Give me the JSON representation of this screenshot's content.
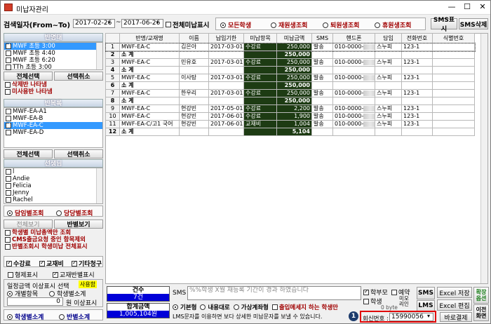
{
  "window": {
    "title": "미납자관리"
  },
  "search": {
    "label": "검색일자(From~To)",
    "from": "2017-02-26",
    "tilde": "~",
    "to": "2017-06-26",
    "all_unpaid": "전체미납표시"
  },
  "filters": {
    "all": "모든학생",
    "enrolled": "재원생조회",
    "withdrawn": "퇴원생조회",
    "leave": "휴원생조회"
  },
  "top_buttons": {
    "sms_show": "SMS표시",
    "sms_delete": "SMS삭제"
  },
  "class_section": {
    "title": "반명태",
    "items": [
      {
        "label": "MWF 초등 3:00",
        "checked": true,
        "selected": true
      },
      {
        "label": "MWF 초등 4:40",
        "checked": false
      },
      {
        "label": "MWF 초등 6:20",
        "checked": false
      },
      {
        "label": "TTh 초등 3:00",
        "checked": false
      }
    ],
    "select_all": "전체선택",
    "deselect": "선택취소",
    "options": [
      "삭제반 나타냄",
      "미사용반 나타냄"
    ]
  },
  "group_section": {
    "title": "반목록",
    "items": [
      {
        "label": "MWF-EA-A1",
        "checked": false
      },
      {
        "label": "MWF-EA-B",
        "checked": false
      },
      {
        "label": "MWF-EA-C",
        "checked": true,
        "selected": true
      },
      {
        "label": "MWF-EA-D",
        "checked": false
      }
    ],
    "select_all": "전체선택",
    "deselect": "선택취소"
  },
  "teacher_section": {
    "title": "선생님",
    "items": [
      {
        "label": "l",
        "checked": false
      },
      {
        "label": "Andie",
        "checked": false
      },
      {
        "label": "Felicia",
        "checked": false
      },
      {
        "label": "Jenny",
        "checked": false
      },
      {
        "label": "Rachel",
        "checked": false
      }
    ]
  },
  "teacher_query": {
    "by_teacher": "담임별조회",
    "by_staff": "당당별조회"
  },
  "view_tabs": {
    "all": "전체보기",
    "by_class": "반별보기"
  },
  "options": {
    "student_total_only": "학생별 미납총액만 조회",
    "cms_exclude": "CMS출금요청 중인 항목제외",
    "class_all_unpaid": "반별조회시 학생미납 전체표시"
  },
  "types": {
    "tuition": "수강료",
    "material": "교재비",
    "other": "기타청구"
  },
  "sibling": "형제표시",
  "material_class": "교재반별표시",
  "amount_filter": {
    "label": "일정금액 이상표시 선택",
    "badge": "사용함",
    "per_item": "개별항목",
    "per_student": "학생별소계",
    "value": "0",
    "unit": "원 이상표시"
  },
  "subtotal_tabs": {
    "student": "학생별소계",
    "class": "반별소계"
  },
  "table": {
    "headers": [
      "",
      "반명/교재명",
      "이름",
      "납입기한",
      "미납항목",
      "미납금액",
      "SMS",
      "핸드폰",
      "담임",
      "전화번호",
      "식별번호"
    ],
    "rows": [
      {
        "n": "1",
        "class": "MWF-EA-C",
        "name": "김은아",
        "due": "2017-03-01",
        "item": "수강료",
        "amount": "250,000",
        "sms": "발송",
        "phone": "010-0000-",
        "teacher": "스누피",
        "tel": "123-1",
        "sub": false
      },
      {
        "n": "2",
        "class": "소 계",
        "name": "",
        "due": "",
        "item": "",
        "amount": "250,000",
        "sms": "",
        "phone": "",
        "teacher": "",
        "tel": "",
        "sub": true
      },
      {
        "n": "3",
        "class": "MWF-EA-C",
        "name": "민유호",
        "due": "2017-03-01",
        "item": "수강료",
        "amount": "250,000",
        "sms": "발송",
        "phone": "010-0000-",
        "teacher": "스누피",
        "tel": "123-1",
        "sub": false
      },
      {
        "n": "4",
        "class": "소 계",
        "name": "",
        "due": "",
        "item": "",
        "amount": "250,000",
        "sms": "",
        "phone": "",
        "teacher": "",
        "tel": "",
        "sub": true
      },
      {
        "n": "5",
        "class": "MWF-EA-C",
        "name": "이사탕",
        "due": "2017-03-01",
        "item": "수강료",
        "amount": "250,000",
        "sms": "발송",
        "phone": "010-0000-",
        "teacher": "스누피",
        "tel": "123-1",
        "sub": false
      },
      {
        "n": "6",
        "class": "소 계",
        "name": "",
        "due": "",
        "item": "",
        "amount": "250,000",
        "sms": "",
        "phone": "",
        "teacher": "",
        "tel": "",
        "sub": true
      },
      {
        "n": "7",
        "class": "MWF-EA-C",
        "name": "한우리",
        "due": "2017-03-01",
        "item": "수강료",
        "amount": "250,000",
        "sms": "발송",
        "phone": "010-0000-",
        "teacher": "스누피",
        "tel": "123-1",
        "sub": false
      },
      {
        "n": "8",
        "class": "소 계",
        "name": "",
        "due": "",
        "item": "",
        "amount": "250,000",
        "sms": "",
        "phone": "",
        "teacher": "",
        "tel": "",
        "sub": true
      },
      {
        "n": "9",
        "class": "MWF-EA-C",
        "name": "현강빈",
        "due": "2017-05-01",
        "item": "수강료",
        "amount": "2,200",
        "sms": "발송",
        "phone": "010-0000-",
        "teacher": "스누피",
        "tel": "123-1",
        "sub": false
      },
      {
        "n": "10",
        "class": "MWF-EA-C",
        "name": "현강빈",
        "due": "2017-06-01",
        "item": "수강료",
        "amount": "1,900",
        "sms": "발송",
        "phone": "010-0000-",
        "teacher": "스누피",
        "tel": "123-1",
        "sub": false
      },
      {
        "n": "11",
        "class": "MWF-EA-C/고1 국어",
        "name": "현강빈",
        "due": "2017-06-01",
        "item": "교재비",
        "amount": "1,004",
        "sms": "발송",
        "phone": "010-0000-",
        "teacher": "스누피",
        "tel": "123-1",
        "sub": false
      },
      {
        "n": "12",
        "class": "소 계",
        "name": "",
        "due": "",
        "item": "",
        "amount": "5,104",
        "sms": "",
        "phone": "",
        "teacher": "",
        "tel": "",
        "sub": true
      }
    ]
  },
  "summary": {
    "count_label": "건수",
    "count": "7건",
    "total_label": "합계금액",
    "total": "1,005,104원"
  },
  "sms": {
    "label": "SMS",
    "placeholder": "%%학생 X월 재등록 기간이 경과 하였습니다",
    "basic": "기본형",
    "content": "내용대로",
    "variable": "가상계좌형",
    "attendance": "출입메세지 하는 학생만",
    "lms_note": "LMS문자를 이용하면  보다 상세한 미납문자를 보낼 수 있습니다.",
    "parent": "학부모",
    "student": "학생",
    "reserve": "예약",
    "bytes": "0 byte",
    "memo": "미모리인",
    "sms_btn": "SMS",
    "lms_btn": "LMS",
    "excel_save": "Excel 저장",
    "excel_edit": "Excel 편집",
    "receipt": "확장옵션",
    "close": "이전화면",
    "member_label": "회신번호 :",
    "member_value": "15990056",
    "pay_btn": "바로결제",
    "marker": "1"
  }
}
